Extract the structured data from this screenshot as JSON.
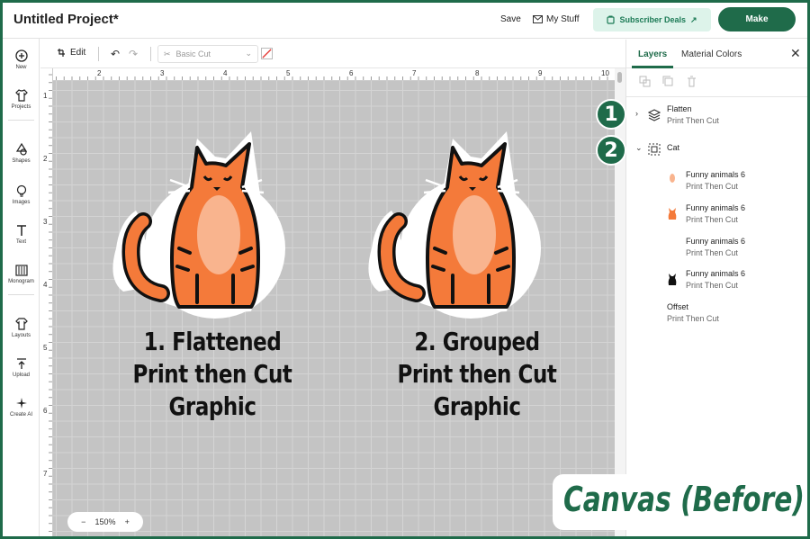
{
  "header": {
    "title": "Untitled Project*",
    "save": "Save",
    "my_stuff": "My Stuff",
    "subscriber_deals": "Subscriber Deals",
    "make": "Make"
  },
  "leftbar": {
    "items": [
      {
        "label": "New",
        "icon": "plus-circle-icon"
      },
      {
        "label": "Projects",
        "icon": "shirt-icon"
      },
      {
        "label": "Shapes",
        "icon": "shapes-icon"
      },
      {
        "label": "Images",
        "icon": "lightbulb-icon"
      },
      {
        "label": "Text",
        "icon": "text-icon"
      },
      {
        "label": "Monogram",
        "icon": "monogram-icon"
      },
      {
        "label": "Layouts",
        "icon": "layouts-icon"
      },
      {
        "label": "Upload",
        "icon": "upload-icon"
      },
      {
        "label": "Create AI",
        "icon": "sparkle-icon"
      }
    ]
  },
  "editbar": {
    "edit": "Edit",
    "operation": "Basic Cut"
  },
  "canvas": {
    "ruler_top": [
      "2",
      "3",
      "4",
      "5",
      "6",
      "7",
      "8",
      "9",
      "10"
    ],
    "ruler_left": [
      "1",
      "2",
      "3",
      "4",
      "5",
      "6",
      "7"
    ],
    "captions": [
      [
        "1. Flattened",
        "Print then Cut",
        "Graphic"
      ],
      [
        "2. Grouped",
        "Print then Cut",
        "Graphic"
      ]
    ],
    "zoom": "150%",
    "zoom_minus": "−",
    "zoom_plus": "+"
  },
  "panel": {
    "tabs": {
      "layers": "Layers",
      "material_colors": "Material Colors"
    },
    "badges": [
      "1",
      "2"
    ],
    "layers": [
      {
        "name": "Flatten",
        "sub": "Print Then Cut"
      },
      {
        "name": "Cat",
        "sub": ""
      },
      {
        "name": "Funny animals 6",
        "sub": "Print Then Cut"
      },
      {
        "name": "Funny animals 6",
        "sub": "Print Then Cut"
      },
      {
        "name": "Funny animals 6",
        "sub": "Print Then Cut"
      },
      {
        "name": "Funny animals 6",
        "sub": "Print Then Cut"
      },
      {
        "name": "Offset",
        "sub": "Print Then Cut"
      }
    ]
  },
  "banner": "Canvas (Before)",
  "colors": {
    "brand_green": "#1f6b4a",
    "cat_orange": "#f47a3a",
    "cat_belly": "#f9b48e"
  }
}
